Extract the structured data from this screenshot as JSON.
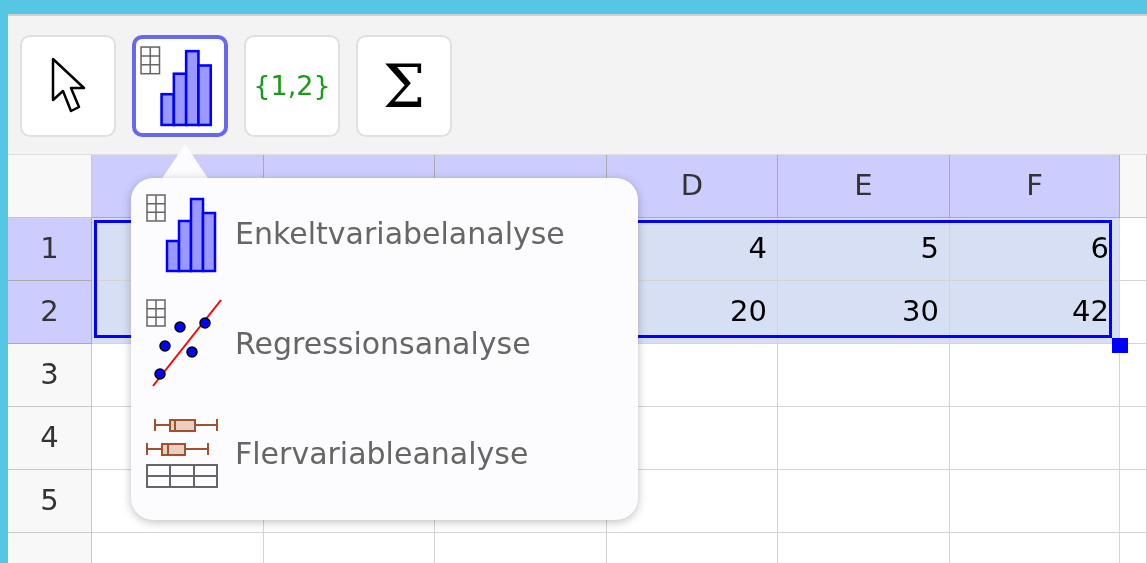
{
  "toolbar": {
    "tools": [
      {
        "kind": "move",
        "selected": false
      },
      {
        "kind": "analysis",
        "selected": true
      },
      {
        "kind": "list",
        "label": "{1,2}",
        "selected": false
      },
      {
        "kind": "sum",
        "label": "Σ",
        "selected": false
      }
    ]
  },
  "spreadsheet": {
    "columns": [
      {
        "selected": true
      },
      {
        "selected": true
      },
      {
        "selected": true
      },
      {
        "label": "D",
        "selected": true
      },
      {
        "label": "E",
        "selected": true
      },
      {
        "label": "F",
        "selected": true
      }
    ],
    "rows": [
      {
        "label": "1",
        "selected": true,
        "cells": [
          "4",
          "5",
          "6"
        ]
      },
      {
        "label": "2",
        "selected": true,
        "cells": [
          "20",
          "30",
          "42"
        ]
      },
      {
        "label": "3",
        "selected": false
      },
      {
        "label": "4",
        "selected": false
      },
      {
        "label": "5",
        "selected": false
      },
      {
        "selected": false
      }
    ]
  },
  "menu": {
    "items": [
      {
        "kind": "one-variable",
        "label": "Enkeltvariabelanalyse"
      },
      {
        "kind": "regression",
        "label": "Regressionsanalyse"
      },
      {
        "kind": "multi-variable",
        "label": "Flervariableanalyse"
      }
    ]
  }
}
